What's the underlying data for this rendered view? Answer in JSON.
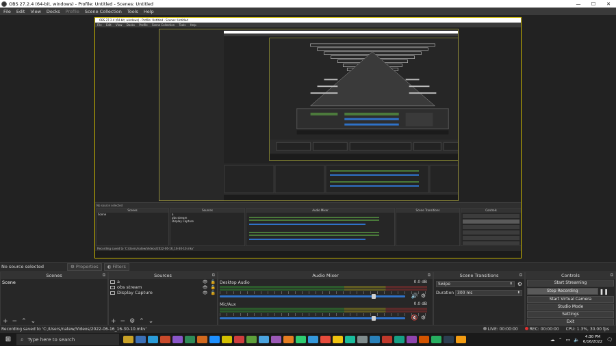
{
  "window": {
    "title": "OBS 27.2.4 (64-bit, windows) - Profile: Untitled - Scenes: Untitled",
    "minimize": "—",
    "maximize": "☐",
    "close": "✕"
  },
  "menu": [
    "File",
    "Edit",
    "View",
    "Docks",
    "Profile",
    "Scene Collection",
    "Tools",
    "Help"
  ],
  "nested": {
    "title": "OBS 27.2.4 (64-bit, windows) - Profile: Untitled - Scenes: Untitled",
    "menu": [
      "File",
      "Edit",
      "View",
      "Docks",
      "Profile",
      "Scene Collection",
      "Tools",
      "Help"
    ],
    "no_source": "No source selected",
    "docks": [
      "Scenes",
      "Sources",
      "Audio Mixer",
      "Scene Transitions",
      "Controls"
    ],
    "scene": "Scene",
    "sources": [
      "a",
      "obs stream",
      "Display Capture"
    ],
    "status": "Recording saved to 'C:/Users/natew/Videos/2022-06-16_16-30-10.mkv'"
  },
  "source_bar": {
    "no_source": "No source selected",
    "properties": "Properties",
    "filters": "Filters"
  },
  "scenes": {
    "header": "Scenes",
    "items": [
      "Scene"
    ]
  },
  "sources": {
    "header": "Sources",
    "items": [
      "a",
      "obs stream",
      "Display Capture"
    ]
  },
  "mixer": {
    "header": "Audio Mixer",
    "channels": [
      {
        "name": "Desktop Audio",
        "db": "0.0 dB",
        "muted": false,
        "level": 0.83
      },
      {
        "name": "Mic/Aux",
        "db": "0.0 dB",
        "muted": true,
        "level": 0.83
      }
    ]
  },
  "transitions": {
    "header": "Scene Transitions",
    "selected": "Swipe",
    "duration_label": "Duration",
    "duration_value": "300 ms"
  },
  "controls": {
    "header": "Controls",
    "buttons": [
      "Start Streaming",
      "Stop Recording",
      "Start Virtual Camera",
      "Studio Mode",
      "Settings",
      "Exit"
    ]
  },
  "status": {
    "message": "Recording saved to 'C:/Users/natew/Videos/2022-06-16_16-30-10.mkv'",
    "live": "LIVE: 00:00:00",
    "rec": "REC: 00:00:00",
    "cpu": "CPU: 1.3%, 30.00 fps"
  },
  "taskbar": {
    "search_placeholder": "Type here to search",
    "time": "4:30 PM",
    "date": "6/16/2022",
    "icon_colors": [
      "#c9a227",
      "#3b6fb6",
      "#2a9bd8",
      "#c94a2b",
      "#8a56c9",
      "#2e8b57",
      "#d2691e",
      "#1e90ff",
      "#d4c000",
      "#cf3e3e",
      "#5e9f3a",
      "#4aa3df",
      "#9b59b6",
      "#e67e22",
      "#2ecc71",
      "#3498db",
      "#e74c3c",
      "#f1c40f",
      "#1abc9c",
      "#7f8c8d",
      "#2980b9",
      "#c0392b",
      "#16a085",
      "#8e44ad",
      "#d35400",
      "#27ae60",
      "#2c3e50",
      "#f39c12"
    ]
  },
  "colors": {
    "canvas_border": "#c8b400",
    "fader": "#2f72c8",
    "rec": "#e03030"
  }
}
